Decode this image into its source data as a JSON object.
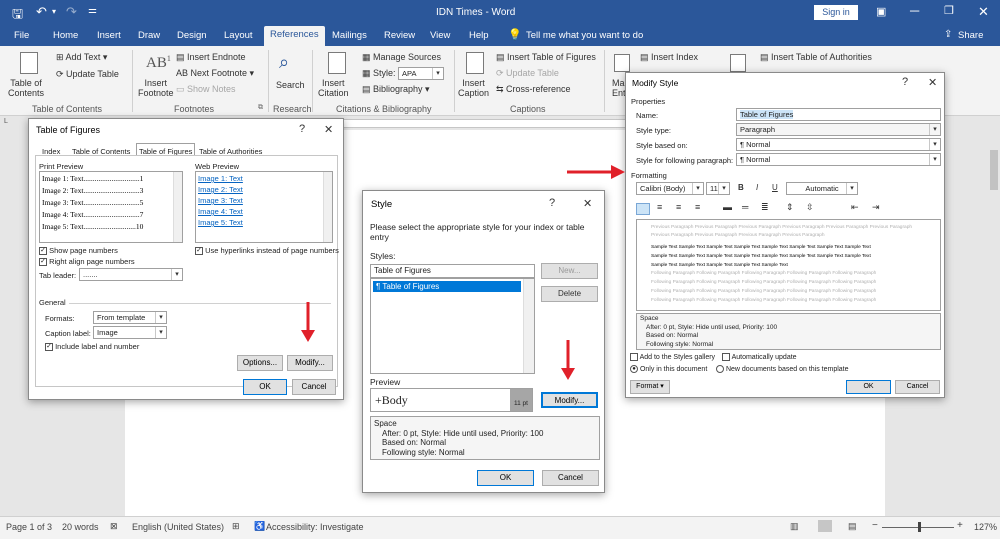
{
  "titlebar": {
    "title": "IDN Times  -  Word",
    "signin": "Sign in"
  },
  "ribbon_tabs": [
    "File",
    "Home",
    "Insert",
    "Draw",
    "Design",
    "Layout",
    "References",
    "Mailings",
    "Review",
    "View",
    "Help"
  ],
  "tell_me": "Tell me what you want to do",
  "share": "Share",
  "ribbon": {
    "toc_label": "Table of\nContents",
    "add_text": "Add Text",
    "update_table": "Update Table",
    "group_toc": "Table of Contents",
    "insert_footnote": "Insert\nFootnote",
    "insert_endnote": "Insert Endnote",
    "next_footnote": "Next Footnote",
    "show_notes": "Show Notes",
    "group_footnotes": "Footnotes",
    "search": "Search",
    "group_research": "Research",
    "insert_citation": "Insert\nCitation",
    "manage_sources": "Manage Sources",
    "style_label": "Style:",
    "style_value": "APA",
    "bibliography": "Bibliography",
    "group_citations": "Citations & Bibliography",
    "insert_caption": "Insert\nCaption",
    "insert_tof": "Insert Table of Figures",
    "update_table2": "Update Table",
    "cross_reference": "Cross-reference",
    "group_captions": "Captions",
    "mark_entry": "Ma\nEnt",
    "insert_index": "Insert Index",
    "insert_toa": "Insert Table of Authorities"
  },
  "status": {
    "page": "Page 1 of 3",
    "words": "20 words",
    "language": "English (United States)",
    "accessibility": "Accessibility: Investigate",
    "zoom": "127%"
  },
  "tof_dialog": {
    "title": "Table of Figures",
    "help": "?",
    "tabs": [
      "Index",
      "Table of Contents",
      "Table of Figures",
      "Table of Authorities"
    ],
    "print_preview_label": "Print Preview",
    "print_preview": [
      "Image 1: Text..............................1",
      "Image 2: Text..............................3",
      "Image 3: Text..............................5",
      "Image 4: Text..............................7",
      "Image 5: Text............................10"
    ],
    "web_preview_label": "Web Preview",
    "web_preview": [
      "Image 1: Text",
      "Image 2: Text",
      "Image 3: Text",
      "Image 4: Text",
      "Image 5: Text"
    ],
    "show_page_numbers": "Show page numbers",
    "right_align": "Right align page numbers",
    "tab_leader_label": "Tab leader:",
    "tab_leader_value": ".......",
    "use_hyperlinks": "Use hyperlinks instead of page numbers",
    "general": "General",
    "formats_label": "Formats:",
    "formats_value": "From template",
    "caption_label": "Caption label:",
    "caption_value": "Image",
    "include_label": "Include label and number",
    "options": "Options...",
    "modify": "Modify...",
    "ok": "OK",
    "cancel": "Cancel"
  },
  "style_dialog": {
    "title": "Style",
    "help": "?",
    "instruction": "Please select the appropriate style for your index or table entry",
    "styles_label": "Styles:",
    "styles_input": "Table of Figures",
    "list_item": "Table of Figures",
    "new_btn": "New...",
    "delete_btn": "Delete",
    "preview_label": "Preview",
    "preview_font": "+Body",
    "preview_size": "11 pt",
    "modify": "Modify...",
    "space_label": "Space",
    "desc_after": "After:  0 pt, Style: Hide until used, Priority: 100",
    "desc_based": "Based on: Normal",
    "desc_following": "Following style: Normal",
    "ok": "OK",
    "cancel": "Cancel"
  },
  "modify_dialog": {
    "title": "Modify Style",
    "help": "?",
    "properties": "Properties",
    "name_label": "Name:",
    "name_value": "Table of Figures",
    "type_label": "Style type:",
    "type_value": "Paragraph",
    "based_label": "Style based on:",
    "based_value": "Normal",
    "following_label": "Style for following paragraph:",
    "following_value": "Normal",
    "formatting": "Formatting",
    "font": "Calibri (Body)",
    "size": "11",
    "bold": "B",
    "italic": "I",
    "underline": "U",
    "color": "Automatic",
    "prev_para": "Previous Paragraph Previous Paragraph Previous Paragraph Previous Paragraph Previous Paragraph Previous Paragraph Previous Paragraph Previous Paragraph Previous Paragraph Previous Paragraph",
    "sample_lines": [
      "Sample Text Sample Text Sample Text Sample Text Sample Text Sample Text Sample Text Sample Text",
      "Sample Text Sample Text Sample Text Sample Text Sample Text Sample Text Sample Text Sample Text",
      "Sample Text Sample Text Sample Text Sample Text Sample Text"
    ],
    "following_para": "Following Paragraph Following Paragraph Following Paragraph Following Paragraph Following Paragraph",
    "space_label": "Space",
    "desc_after": "After:  0 pt, Style: Hide until used, Priority: 100",
    "desc_based": "Based on: Normal",
    "desc_following": "Following style: Normal",
    "add_gallery": "Add to the Styles gallery",
    "auto_update": "Automatically update",
    "only_doc": "Only in this document",
    "new_docs": "New documents based on this template",
    "format": "Format",
    "ok": "OK",
    "cancel": "Cancel"
  },
  "colors": {
    "accent": "#2b579a",
    "arrow": "#e0202a",
    "selection": "#0078d7"
  }
}
